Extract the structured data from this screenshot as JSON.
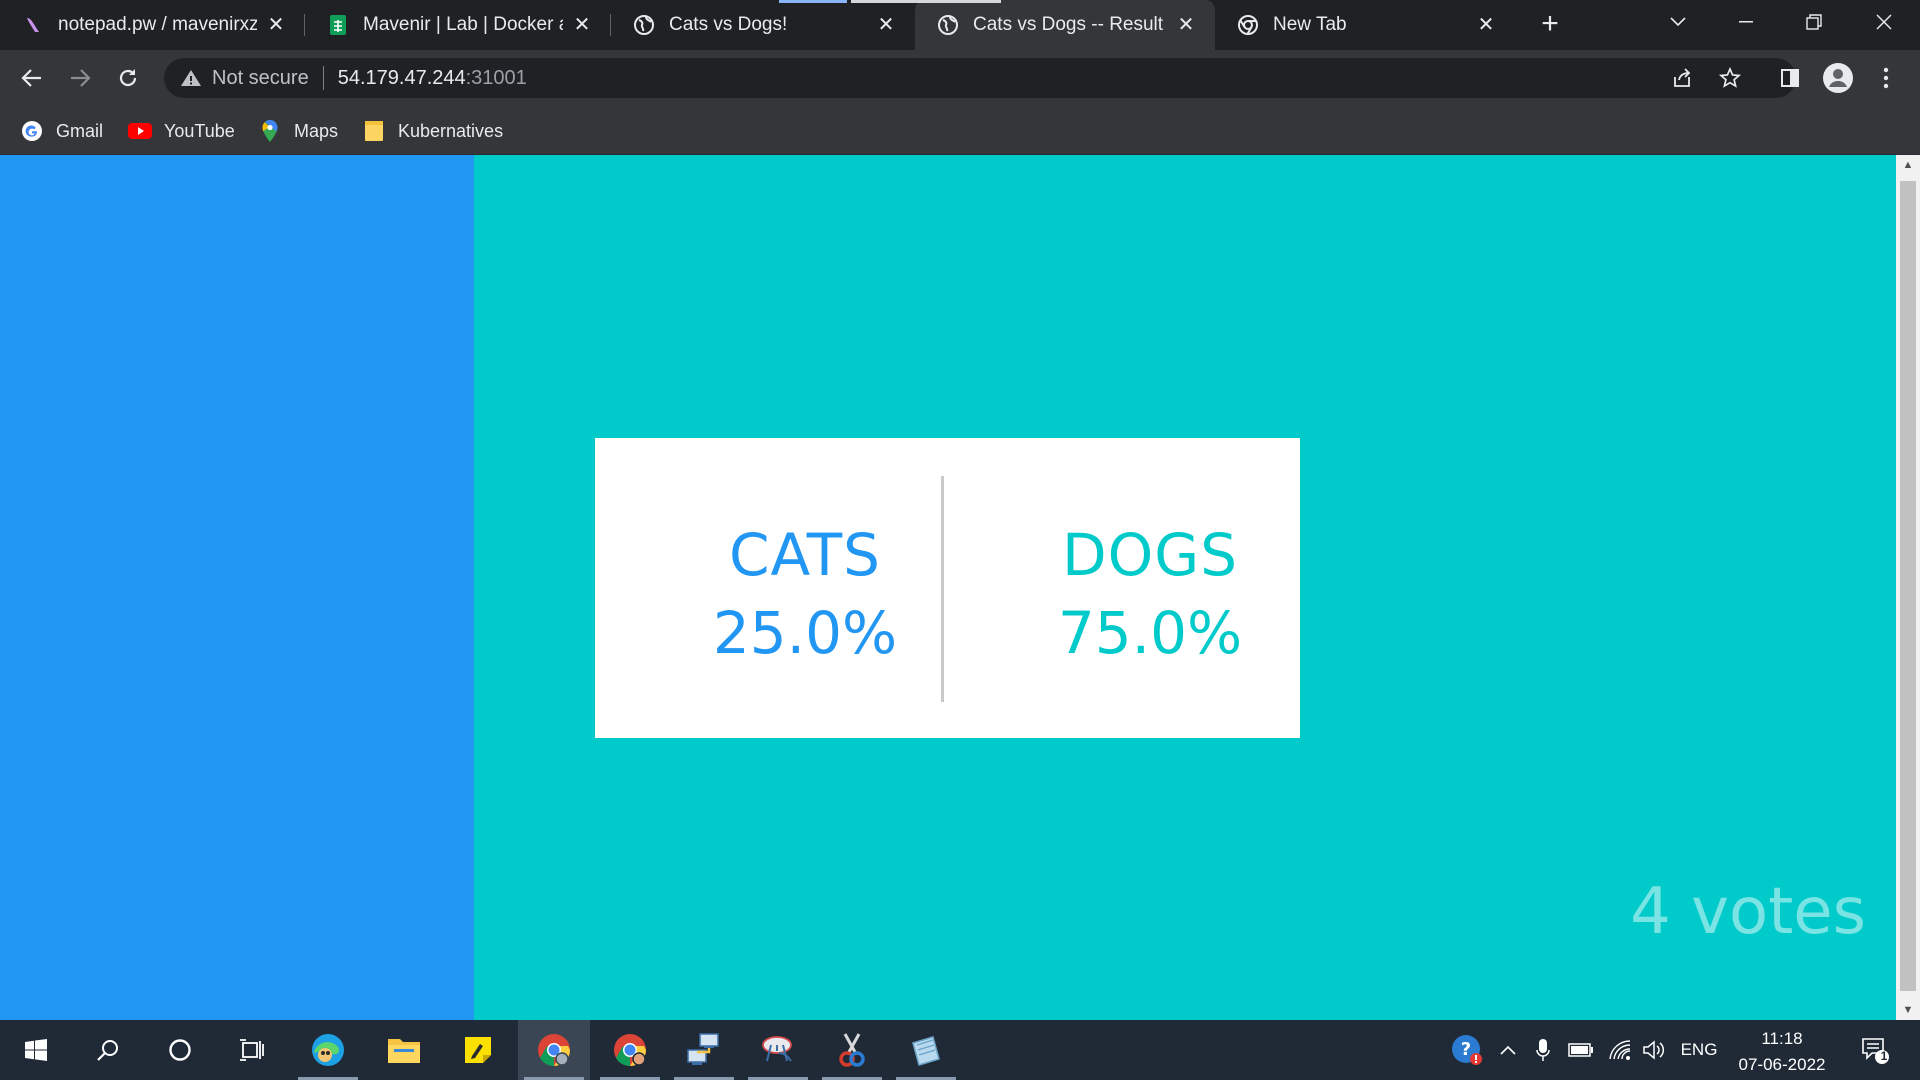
{
  "browser": {
    "tabs": [
      {
        "title": "notepad.pw / mavenirxz-l",
        "icon": "notepad-icon",
        "active": false
      },
      {
        "title": "Mavenir | Lab | Docker and",
        "icon": "sheets-icon",
        "active": false
      },
      {
        "title": "Cats vs Dogs!",
        "icon": "globe-icon",
        "active": false
      },
      {
        "title": "Cats vs Dogs -- Result",
        "icon": "globe-icon",
        "active": true
      },
      {
        "title": "New Tab",
        "icon": "chrome-icon",
        "active": false
      }
    ],
    "close_glyph": "✕",
    "new_tab_glyph": "+",
    "omnibox": {
      "security_label": "Not secure",
      "host": "54.179.47.244",
      "port": ":31001"
    },
    "bookmarks": [
      {
        "label": "Gmail",
        "icon": "google-icon"
      },
      {
        "label": "YouTube",
        "icon": "youtube-icon"
      },
      {
        "label": "Maps",
        "icon": "maps-icon"
      },
      {
        "label": "Kubernatives",
        "icon": "folder-icon"
      }
    ]
  },
  "page": {
    "colors": {
      "cats": "#2196f3",
      "dogs": "#00cbca",
      "votes": "#7ae3e3"
    },
    "cats": {
      "label": "CATS",
      "percent": "25.0%"
    },
    "dogs": {
      "label": "DOGS",
      "percent": "75.0%"
    },
    "votes": "4 votes"
  },
  "taskbar": {
    "apps": [
      "start-icon",
      "search-icon",
      "cortana-icon",
      "task-view-icon",
      "edge-icon",
      "file-explorer-icon",
      "sticky-notes-icon",
      "chrome-icon",
      "chrome-profile-icon",
      "network-tool-icon",
      "satellite-dish-icon",
      "snipping-tool-icon",
      "notepad-tool-icon"
    ],
    "tray": {
      "language": "ENG",
      "time": "11:18",
      "date": "07-06-2022",
      "notifications_count": "1"
    }
  }
}
